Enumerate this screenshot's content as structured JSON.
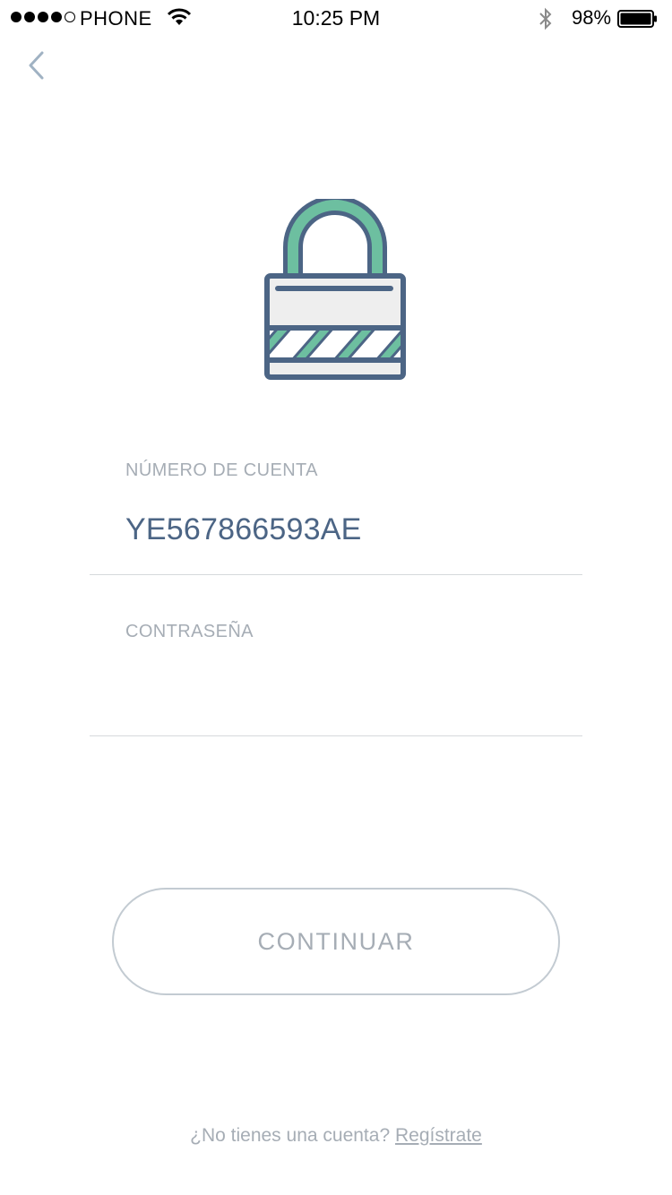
{
  "status_bar": {
    "carrier": "PHONE",
    "time": "10:25 PM",
    "battery_percent": "98%",
    "signal_bars_filled": 4,
    "signal_bars_total": 5
  },
  "nav": {
    "back_icon": "chevron-left-icon"
  },
  "hero": {
    "icon": "padlock-icon",
    "colors": {
      "outline": "#4c6585",
      "accent": "#6dbfa0",
      "fill": "#eeeeee"
    }
  },
  "form": {
    "account": {
      "label": "NÚMERO DE CUENTA",
      "value": "YE567866593AE"
    },
    "password": {
      "label": "CONTRASEÑA",
      "value": ""
    }
  },
  "actions": {
    "continue_label": "CONTINUAR"
  },
  "footer": {
    "question": "¿No tienes una cuenta?",
    "link": "Regístrate"
  }
}
